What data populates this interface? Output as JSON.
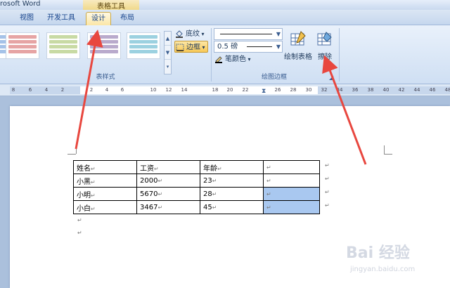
{
  "window": {
    "app_title": "rosoft Word",
    "contextual_title": "表格工具"
  },
  "tabs": [
    {
      "label": "视图"
    },
    {
      "label": "开发工具"
    },
    {
      "label": "设计",
      "active": true
    },
    {
      "label": "布局"
    }
  ],
  "ribbon": {
    "table_styles_group": "表样式",
    "draw_borders_group": "绘图边框",
    "shading_label": "底纹",
    "borders_label": "边框",
    "pen_color_label": "笔颜色",
    "line_weight_value": "0.5 磅",
    "draw_table_label": "绘制表格",
    "eraser_label": "擦除",
    "style_colors": [
      "#5b8fd6",
      "#d25a5a",
      "#9bbb59",
      "#8064a2",
      "#4bacc6"
    ]
  },
  "ruler": {
    "ticks": [
      "8",
      "6",
      "4",
      "2",
      "2",
      "4",
      "6",
      "10",
      "12",
      "14",
      "18",
      "20",
      "22",
      "26",
      "28",
      "30",
      "32",
      "34",
      "36",
      "38",
      "40",
      "42",
      "44",
      "46",
      "48"
    ]
  },
  "table": {
    "rows": [
      [
        "姓名",
        "工资",
        "年龄",
        ""
      ],
      [
        "小黑",
        "2000",
        "23",
        ""
      ],
      [
        "小明",
        "5670",
        "28",
        ""
      ],
      [
        "小白",
        "3467",
        "45",
        ""
      ]
    ],
    "selected_cells": [
      [
        2,
        3
      ],
      [
        3,
        3
      ]
    ]
  },
  "marks": {
    "cell_mark": "↵",
    "para_mark": "↵"
  },
  "watermark": {
    "logo": "Bai 经验",
    "url": "jingyan.baidu.com"
  },
  "colors": {
    "accent_arrow": "#e8473f",
    "selection": "#a9c8f0"
  }
}
